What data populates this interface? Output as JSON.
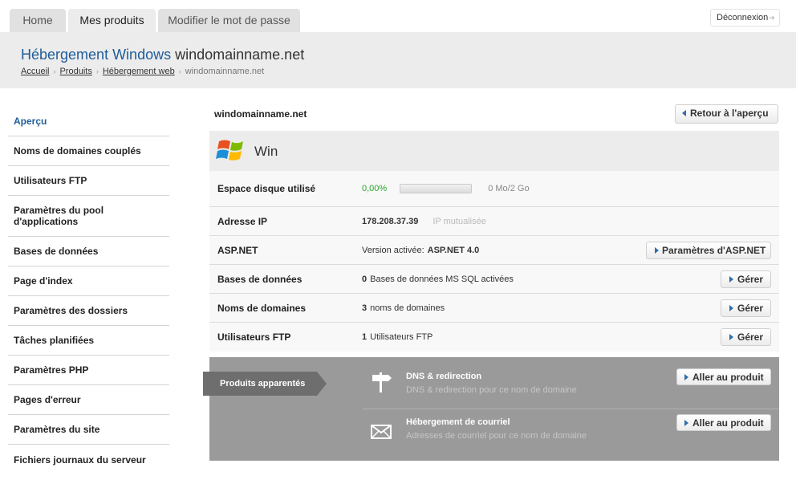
{
  "tabs": [
    {
      "label": "Home"
    },
    {
      "label": "Mes produits"
    },
    {
      "label": "Modifier le mot de passe"
    }
  ],
  "logout_label": "Déconnexion",
  "header": {
    "title_prefix": "Hébergement Windows",
    "title_domain": "windomainname.net",
    "breadcrumb": [
      "Accueil",
      "Produits",
      "Hébergement web",
      "windomainname.net"
    ]
  },
  "sidebar": {
    "items": [
      {
        "label": "Aperçu"
      },
      {
        "label": "Noms de domaines couplés"
      },
      {
        "label": "Utilisateurs FTP"
      },
      {
        "label": "Paramètres du pool d'applications"
      },
      {
        "label": "Bases de données"
      },
      {
        "label": "Page d'index"
      },
      {
        "label": "Paramètres des dossiers"
      },
      {
        "label": "Tâches planifiées"
      },
      {
        "label": "Paramètres PHP"
      },
      {
        "label": "Pages d'erreur"
      },
      {
        "label": "Paramètres du site"
      },
      {
        "label": "Fichiers journaux du serveur"
      }
    ]
  },
  "main": {
    "domain": "windomainname.net",
    "back_label": "Retour à l'aperçu",
    "os_title": "Win",
    "disk": {
      "label": "Espace disque utilisé",
      "percent_text": "0,00%",
      "used_fraction": 0.0,
      "usage_text": "0 Mo/2 Go"
    },
    "ip": {
      "label": "Adresse IP",
      "value": "178.208.37.39",
      "note": "IP mutualisée"
    },
    "asp": {
      "label": "ASP.NET",
      "prefix": "Version activée:",
      "value": "ASP.NET 4.0",
      "button": "Paramètres d'ASP.NET"
    },
    "db": {
      "label": "Bases de données",
      "count": "0",
      "text": "Bases de données MS SQL activées",
      "button": "Gérer"
    },
    "domains": {
      "label": "Noms de domaines",
      "count": "3",
      "text": "noms de domaines",
      "button": "Gérer"
    },
    "ftp": {
      "label": "Utilisateurs FTP",
      "count": "1",
      "text": "Utilisateurs FTP",
      "button": "Gérer"
    }
  },
  "related": {
    "tag": "Produits apparentés",
    "items": [
      {
        "title": "DNS & redirection",
        "desc": "DNS & redirection pour ce nom de domaine",
        "button": "Aller au produit",
        "icon": "signpost-icon"
      },
      {
        "title": "Hébergement de courriel",
        "desc": "Adresses de courriel pour ce nom de domaine",
        "button": "Aller au produit",
        "icon": "envelope-icon"
      }
    ]
  },
  "colors": {
    "accent": "#1f5c99",
    "success": "#2aa52a",
    "related_bg": "#9a9a9a"
  }
}
